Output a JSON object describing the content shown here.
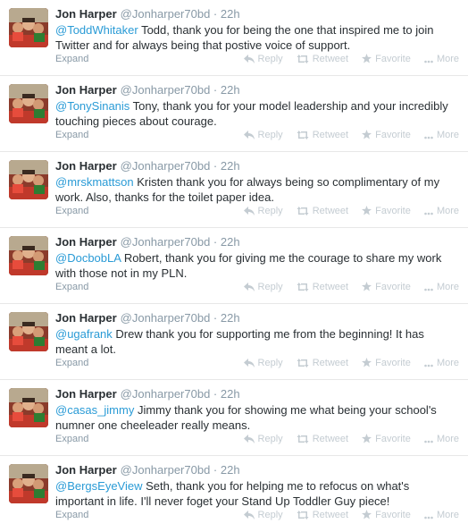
{
  "tweets": [
    {
      "fullname": "Jon Harper",
      "username": "@Jonharper70bd",
      "separator": "·",
      "time": "22h",
      "mention": "@ToddWhitaker",
      "text": " Todd, thank you for being the one that inspired me to join Twitter and for always being that postive voice of support."
    },
    {
      "fullname": "Jon Harper",
      "username": "@Jonharper70bd",
      "separator": "·",
      "time": "22h",
      "mention": "@TonySinanis",
      "text": " Tony, thank you for your model leadership and your incredibly touching pieces about courage."
    },
    {
      "fullname": "Jon Harper",
      "username": "@Jonharper70bd",
      "separator": "·",
      "time": "22h",
      "mention": "@mrskmattson",
      "text": " Kristen thank you for always being so complimentary of my work. Also, thanks for the toilet paper idea."
    },
    {
      "fullname": "Jon Harper",
      "username": "@Jonharper70bd",
      "separator": "·",
      "time": "22h",
      "mention": "@DocbobLA",
      "text": " Robert, thank you for giving me the courage to share my work with those not in my PLN."
    },
    {
      "fullname": "Jon Harper",
      "username": "@Jonharper70bd",
      "separator": "·",
      "time": "22h",
      "mention": "@ugafrank",
      "text": " Drew thank you for supporting me from the beginning! It has meant a lot."
    },
    {
      "fullname": "Jon Harper",
      "username": "@Jonharper70bd",
      "separator": "·",
      "time": "22h",
      "mention": "@casas_jimmy",
      "text": " Jimmy thank you for showing me what being your school's numner one cheeleader really means."
    },
    {
      "fullname": "Jon Harper",
      "username": "@Jonharper70bd",
      "separator": "·",
      "time": "22h",
      "mention": "@BergsEyeView",
      "text": " Seth, thank you for helping me to refocus on what's important in life. I'll never foget your Stand Up Toddler Guy piece!"
    }
  ],
  "labels": {
    "expand": "Expand",
    "reply": "Reply",
    "retweet": "Retweet",
    "favorite": "Favorite",
    "more": "More"
  },
  "icons": {
    "reply": "reply-icon",
    "retweet": "retweet-icon",
    "favorite": "star-icon",
    "more": "more-dots-icon"
  },
  "colors": {
    "mention": "#2a9bd6",
    "muted": "#8899a6",
    "action": "#c4ccd2",
    "text": "#292f33"
  }
}
